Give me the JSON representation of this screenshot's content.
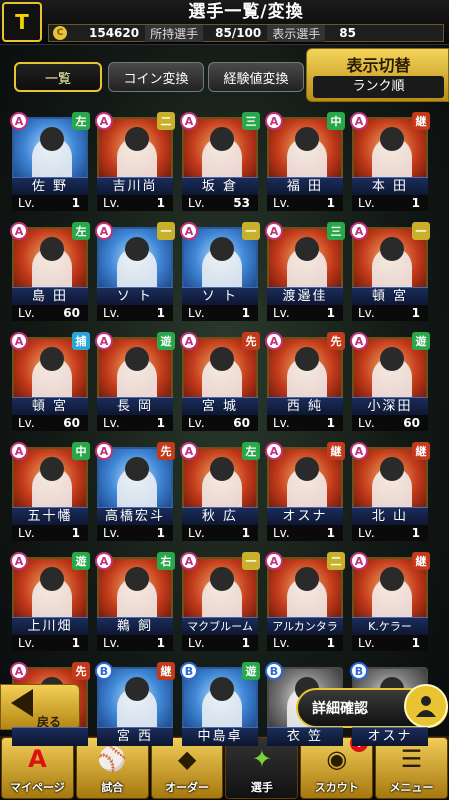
{
  "header": {
    "title": "選手一覧/変換",
    "logo": "T"
  },
  "stats": {
    "coins": "154620",
    "owned_label": "所持選手",
    "owned": "85/100",
    "shown_label": "表示選手",
    "shown": "85"
  },
  "tabs": [
    {
      "label": "一覧"
    },
    {
      "label": "コイン変換"
    },
    {
      "label": "経験値変換"
    }
  ],
  "display_toggle": {
    "title": "表示切替",
    "value": "ランク順"
  },
  "lv_label": "Lv.",
  "cards": [
    {
      "name": "佐 野",
      "lv": "1",
      "rank": "A",
      "pos": "左",
      "tone": "blue"
    },
    {
      "name": "吉川尚",
      "lv": "1",
      "rank": "A",
      "pos": "二",
      "tone": "red"
    },
    {
      "name": "坂 倉",
      "lv": "53",
      "rank": "A",
      "pos": "三",
      "tone": "red"
    },
    {
      "name": "福 田",
      "lv": "1",
      "rank": "A",
      "pos": "中",
      "tone": "red"
    },
    {
      "name": "本 田",
      "lv": "1",
      "rank": "A",
      "pos": "継",
      "tone": "red"
    },
    {
      "name": "島 田",
      "lv": "60",
      "rank": "A",
      "pos": "左",
      "tone": "red"
    },
    {
      "name": "ソ ト",
      "lv": "1",
      "rank": "A",
      "pos": "一",
      "tone": "blue"
    },
    {
      "name": "ソ ト",
      "lv": "1",
      "rank": "A",
      "pos": "一",
      "tone": "blue"
    },
    {
      "name": "渡邉佳",
      "lv": "1",
      "rank": "A",
      "pos": "三",
      "tone": "red"
    },
    {
      "name": "頓 宮",
      "lv": "1",
      "rank": "A",
      "pos": "一",
      "tone": "red"
    },
    {
      "name": "頓 宮",
      "lv": "60",
      "rank": "A",
      "pos": "捕",
      "tone": "red"
    },
    {
      "name": "長 岡",
      "lv": "1",
      "rank": "A",
      "pos": "遊",
      "tone": "red"
    },
    {
      "name": "宮 城",
      "lv": "60",
      "rank": "A",
      "pos": "先",
      "tone": "red"
    },
    {
      "name": "西 純",
      "lv": "1",
      "rank": "A",
      "pos": "先",
      "tone": "red"
    },
    {
      "name": "小深田",
      "lv": "60",
      "rank": "A",
      "pos": "遊",
      "tone": "red"
    },
    {
      "name": "五十幡",
      "lv": "1",
      "rank": "A",
      "pos": "中",
      "tone": "red"
    },
    {
      "name": "高橋宏斗",
      "lv": "1",
      "rank": "A",
      "pos": "先",
      "tone": "blue"
    },
    {
      "name": "秋 広",
      "lv": "1",
      "rank": "A",
      "pos": "左",
      "tone": "red"
    },
    {
      "name": "オスナ",
      "lv": "1",
      "rank": "A",
      "pos": "継",
      "tone": "red"
    },
    {
      "name": "北 山",
      "lv": "1",
      "rank": "A",
      "pos": "継",
      "tone": "red"
    },
    {
      "name": "上川畑",
      "lv": "1",
      "rank": "A",
      "pos": "遊",
      "tone": "red"
    },
    {
      "name": "鵜 飼",
      "lv": "1",
      "rank": "A",
      "pos": "右",
      "tone": "red"
    },
    {
      "name": "マクブルーム",
      "lv": "1",
      "rank": "A",
      "pos": "一",
      "tone": "red"
    },
    {
      "name": "アルカンタラ",
      "lv": "1",
      "rank": "A",
      "pos": "二",
      "tone": "red"
    },
    {
      "name": "K.ケラー",
      "lv": "1",
      "rank": "A",
      "pos": "継",
      "tone": "red"
    },
    {
      "name": "",
      "lv": "",
      "rank": "A",
      "pos": "先",
      "tone": "red"
    },
    {
      "name": "宮 西",
      "lv": "",
      "rank": "B",
      "pos": "継",
      "tone": "blue"
    },
    {
      "name": "中島卓",
      "lv": "",
      "rank": "B",
      "pos": "遊",
      "tone": "blue"
    },
    {
      "name": "衣 笠",
      "lv": "",
      "rank": "B",
      "pos": "",
      "tone": "dark"
    },
    {
      "name": "オスナ",
      "lv": "",
      "rank": "B",
      "pos": "",
      "tone": "dark"
    }
  ],
  "bottom": {
    "back": "戻る",
    "detail": "詳細確認"
  },
  "nav": [
    {
      "label": "マイページ",
      "icon": "A"
    },
    {
      "label": "試合",
      "icon": "⚾"
    },
    {
      "label": "オーダー",
      "icon": "◆"
    },
    {
      "label": "選手",
      "icon": "✦"
    },
    {
      "label": "スカウト",
      "icon": "◉",
      "badge": "!"
    },
    {
      "label": "メニュー",
      "icon": "☰"
    }
  ]
}
